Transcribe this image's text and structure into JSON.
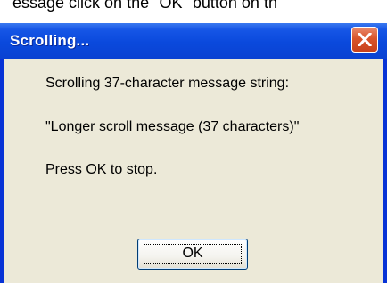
{
  "background": {
    "caption_fragment": "essage click on the \"OK\" button on th"
  },
  "dialog": {
    "title": "Scrolling...",
    "close_icon": "close-x-icon",
    "lines": [
      "Scrolling 37-character message string:",
      "\"Longer scroll message (37 characters)\"",
      "Press OK to stop."
    ],
    "ok_label": "OK"
  },
  "colors": {
    "titlebar": "#0a49dc",
    "client": "#ece9d8",
    "close_button": "#d9552c"
  }
}
